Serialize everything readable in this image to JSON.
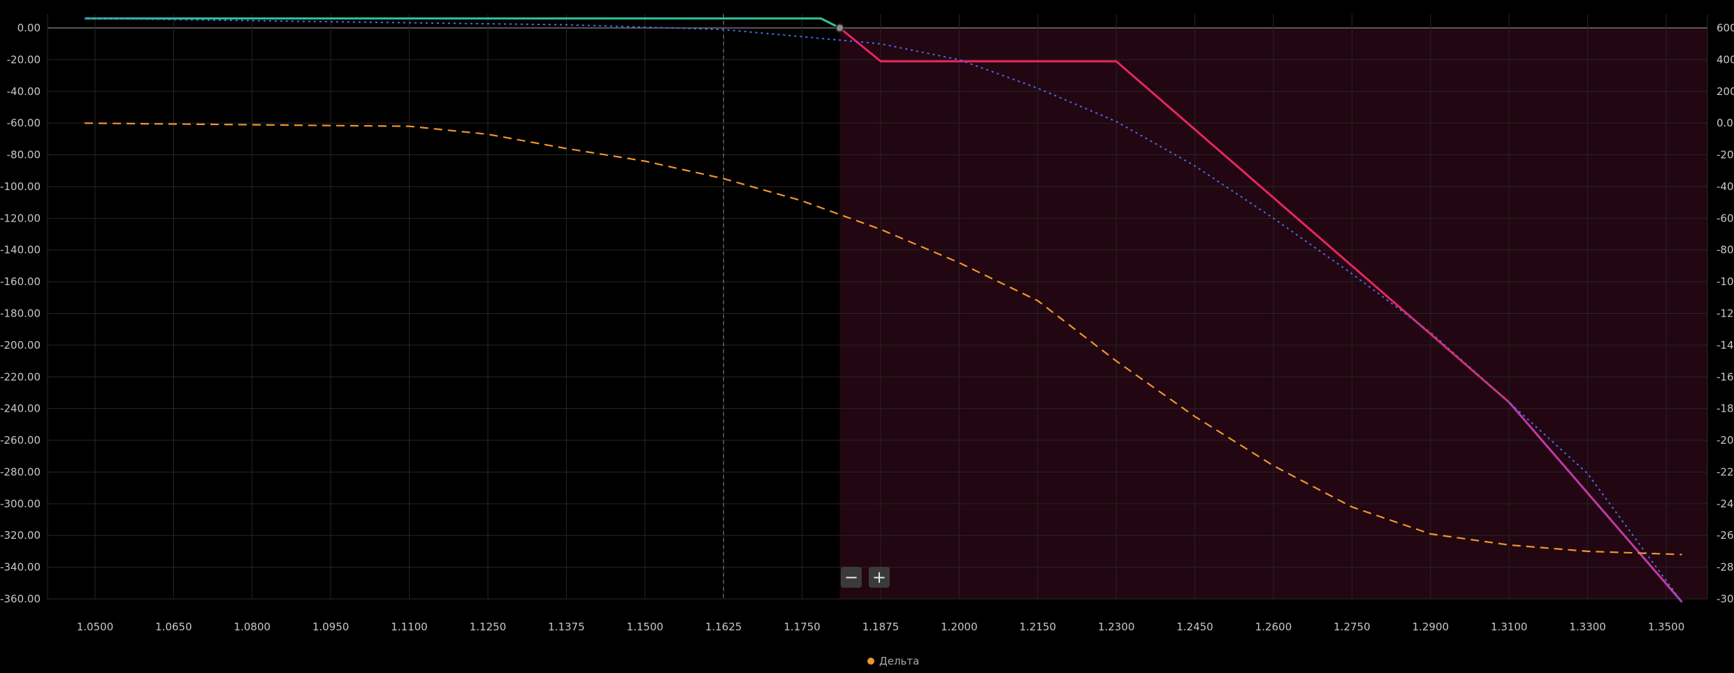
{
  "chart_data": {
    "type": "line",
    "x_ticks": [
      "1.0500",
      "1.0650",
      "1.0800",
      "1.0950",
      "1.1100",
      "1.1250",
      "1.1375",
      "1.1500",
      "1.1625",
      "1.1750",
      "1.1875",
      "1.2000",
      "1.2150",
      "1.2300",
      "1.2450",
      "1.2600",
      "1.2750",
      "1.2900",
      "1.3100",
      "1.3300",
      "1.3500"
    ],
    "x_tick_values": [
      1.05,
      1.065,
      1.08,
      1.095,
      1.11,
      1.125,
      1.1375,
      1.15,
      1.1625,
      1.175,
      1.1875,
      1.2,
      1.215,
      1.23,
      1.245,
      1.26,
      1.275,
      1.29,
      1.31,
      1.33,
      1.35
    ],
    "x_tick_positions": [
      0,
      1,
      2,
      3,
      4,
      5,
      6,
      7,
      8,
      9,
      10,
      11,
      12,
      13,
      14,
      15,
      16,
      17,
      18,
      19,
      20
    ],
    "left_axis": {
      "ticks": [
        "0.00",
        "-20.00",
        "-40.00",
        "-60.00",
        "-80.00",
        "-100.00",
        "-120.00",
        "-140.00",
        "-160.00",
        "-180.00",
        "-200.00",
        "-220.00",
        "-240.00",
        "-260.00",
        "-280.00",
        "-300.00",
        "-320.00",
        "-340.00",
        "-360.00"
      ],
      "ylim": [
        -360,
        0
      ]
    },
    "right_axis": {
      "ticks": [
        "600",
        "400",
        "200",
        "0.0",
        "-20",
        "-40",
        "-60",
        "-80",
        "-10",
        "-12",
        "-14",
        "-16",
        "-18",
        "-20",
        "-22",
        "-24",
        "-26",
        "-28",
        "-30"
      ]
    },
    "current_price": 1.1625,
    "breakeven_x": 1.181,
    "loss_area_color": "#220611",
    "series": [
      {
        "kind": "payoff-profit",
        "color": "#2fc39a",
        "style": "solid",
        "points": [
          [
            1.048,
            6
          ],
          [
            1.178,
            6
          ],
          [
            1.181,
            0
          ]
        ]
      },
      {
        "kind": "payoff-loss",
        "color": "#e8255f",
        "style": "solid",
        "points": [
          [
            1.181,
            0
          ],
          [
            1.1875,
            -21
          ],
          [
            1.23,
            -21
          ],
          [
            1.31,
            -236
          ]
        ]
      },
      {
        "kind": "payoff-loss-tail",
        "color": "#c03aa8",
        "style": "solid",
        "points": [
          [
            1.31,
            -236
          ],
          [
            1.354,
            -362
          ]
        ]
      },
      {
        "kind": "theoretical",
        "color": "#4a6cf0",
        "style": "dotted",
        "points": [
          [
            1.048,
            6
          ],
          [
            1.1375,
            2
          ],
          [
            1.1625,
            -1
          ],
          [
            1.1875,
            -10
          ],
          [
            1.2,
            -20
          ],
          [
            1.215,
            -38
          ],
          [
            1.23,
            -59
          ],
          [
            1.245,
            -87
          ],
          [
            1.26,
            -120
          ],
          [
            1.275,
            -155
          ],
          [
            1.29,
            -192
          ],
          [
            1.31,
            -236
          ],
          [
            1.33,
            -281
          ],
          [
            1.354,
            -362
          ]
        ]
      },
      {
        "name": "Дельта",
        "kind": "delta",
        "color": "#f0962e",
        "style": "dashed",
        "points": [
          [
            1.048,
            -60
          ],
          [
            1.11,
            -62
          ],
          [
            1.125,
            -67
          ],
          [
            1.1375,
            -76
          ],
          [
            1.15,
            -84
          ],
          [
            1.1625,
            -95
          ],
          [
            1.175,
            -109
          ],
          [
            1.1875,
            -127
          ],
          [
            1.2,
            -148
          ],
          [
            1.215,
            -172
          ],
          [
            1.23,
            -210
          ],
          [
            1.245,
            -245
          ],
          [
            1.26,
            -276
          ],
          [
            1.275,
            -302
          ],
          [
            1.29,
            -319
          ],
          [
            1.31,
            -326
          ],
          [
            1.33,
            -330
          ],
          [
            1.354,
            -332
          ]
        ]
      }
    ],
    "legend": [
      {
        "label": "Дельта",
        "color": "#f0962e"
      }
    ]
  },
  "zoom": {
    "minus": "−",
    "plus": "+"
  }
}
